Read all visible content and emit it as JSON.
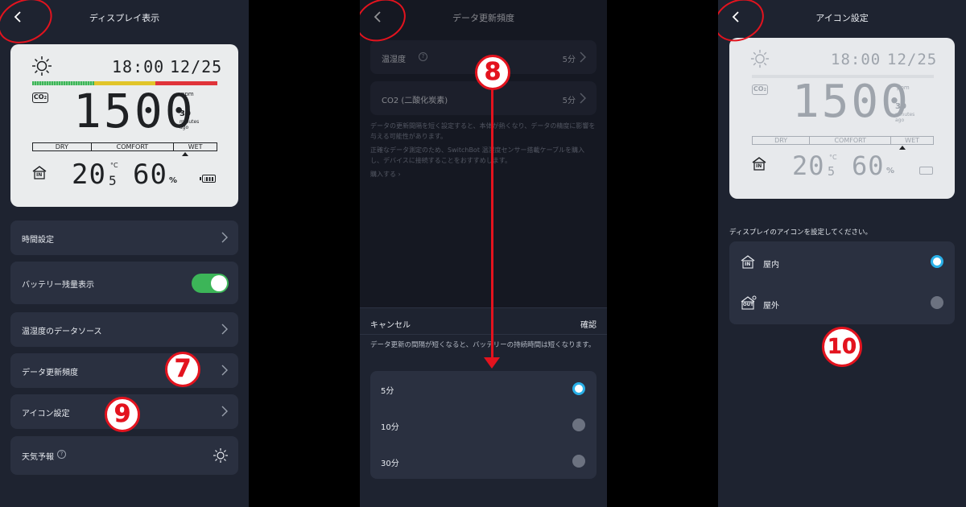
{
  "colors": {
    "bg": "#1e2330",
    "card": "#2a3040",
    "accent_green": "#3cb558",
    "accent_blue": "#29b0e8",
    "annotation_red": "#e3131e"
  },
  "display_screen": {
    "title": "ディスプレイ表示",
    "time": "18:00",
    "date": "12/25",
    "co2_value": "1500",
    "co2_unit": "ppm",
    "minutes_ago_num": "30",
    "minutes_ago_l1": "minutes",
    "minutes_ago_l2": "ago",
    "comfort_dry": "DRY",
    "comfort_comfort": "COMFORT",
    "comfort_wet": "WET",
    "temp_int": "20",
    "temp_dec": "5",
    "temp_unit": "°C",
    "humidity": "60",
    "humidity_unit": "%",
    "co2_label": "CO",
    "co2_sub": "2",
    "in_label": "IN",
    "settings": [
      {
        "label": "時間設定"
      },
      {
        "label": "バッテリー残量表示",
        "toggle_on": true
      },
      {
        "label": "温湿度のデータソース"
      },
      {
        "label": "データ更新頻度"
      },
      {
        "label": "アイコン設定"
      },
      {
        "label": "天気予報"
      }
    ],
    "badge_7": "7",
    "badge_9": "9"
  },
  "frequency_screen": {
    "title": "データ更新頻度",
    "rows": [
      {
        "label": "温湿度",
        "value": "5分"
      },
      {
        "label": "CO2 (二酸化炭素)",
        "value": "5分"
      }
    ],
    "note_1": "データの更新間隔を短く設定すると、本体が熱くなり、データの精度に影響を与える可能性があります。",
    "note_2": "正確なデータ測定のため、SwitchBot 温湿度センサー搭載ケーブルを購入し、デバイスに接続することをおすすめします。",
    "buy_link": "購入する",
    "sheet": {
      "cancel": "キャンセル",
      "confirm": "確認",
      "message": "データ更新の間隔が短くなると、バッテリーの持続時間は短くなります。",
      "options": [
        {
          "label": "5分",
          "selected": true
        },
        {
          "label": "10分",
          "selected": false
        },
        {
          "label": "30分",
          "selected": false
        }
      ]
    },
    "badge_8": "8"
  },
  "icon_screen": {
    "title": "アイコン設定",
    "instruction": "ディスプレイのアイコンを設定してください。",
    "options": [
      {
        "label": "屋内",
        "icon_text": "IN",
        "selected": true
      },
      {
        "label": "屋外",
        "icon_text": "OUT",
        "selected": false
      }
    ],
    "badge_10": "10"
  }
}
